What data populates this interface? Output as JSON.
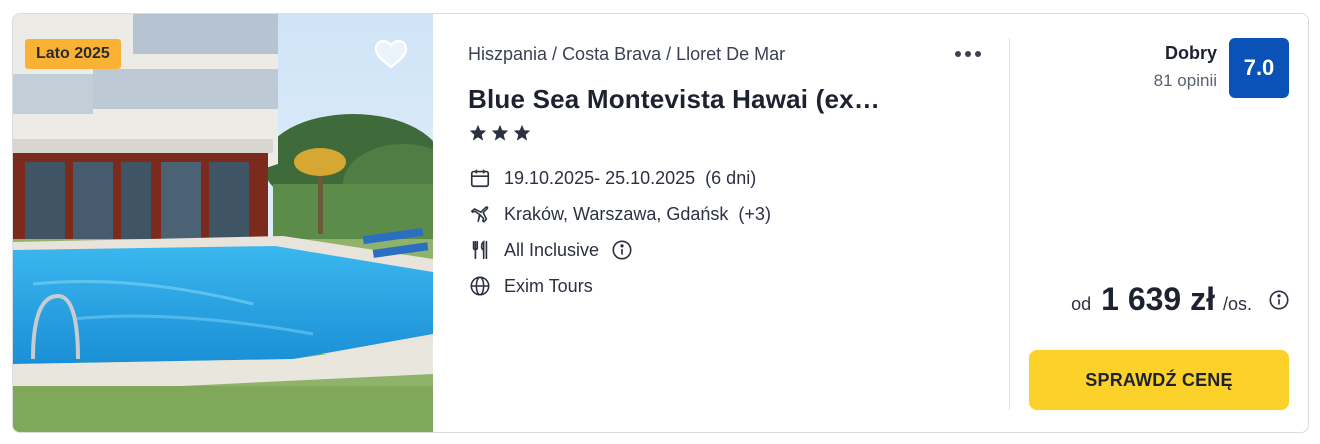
{
  "offer": {
    "season_badge": "Lato 2025",
    "breadcrumb": [
      "Hiszpania",
      "Costa Brava",
      "Lloret De Mar"
    ],
    "breadcrumb_sep": "/",
    "hotel_name": "Blue Sea Montevista Hawai (ex…",
    "stars": 3,
    "dates": "19.10.2025- 25.10.2025",
    "duration": "(6 dni)",
    "departures": "Kraków, Warszawa, Gdańsk",
    "departures_more": "(+3)",
    "board": "All Inclusive",
    "operator": "Exim Tours",
    "icons": {
      "favorite": "heart-icon",
      "more": "more-options-icon",
      "dates": "calendar-icon",
      "departures": "plane-icon",
      "board": "cutlery-icon",
      "board_info": "info-icon",
      "operator": "globe-icon",
      "price_info": "info-icon"
    }
  },
  "rating": {
    "label": "Dobry",
    "reviews": "81 opinii",
    "score": "7.0",
    "badge_color": "#0a52b8"
  },
  "price": {
    "prefix": "od",
    "amount": "1 639 zł",
    "suffix": "/os."
  },
  "cta": {
    "label": "SPRAWDŹ CENĘ",
    "color": "#fcd129"
  },
  "colors": {
    "season_badge": "#f9b233"
  }
}
